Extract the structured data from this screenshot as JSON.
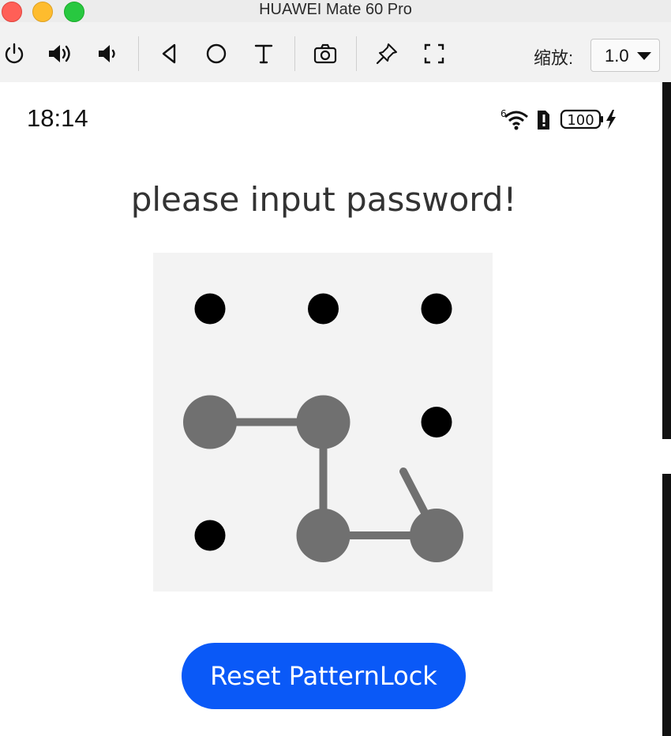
{
  "window": {
    "title": "HUAWEI Mate 60 Pro"
  },
  "toolbar": {
    "tools": [
      {
        "name": "power-icon"
      },
      {
        "name": "volume-up-icon"
      },
      {
        "name": "volume-down-icon"
      },
      {
        "name": "back-icon"
      },
      {
        "name": "home-icon"
      },
      {
        "name": "text-icon"
      },
      {
        "name": "camera-icon"
      },
      {
        "name": "pin-icon"
      },
      {
        "name": "fullscreen-icon"
      }
    ],
    "zoom_label": "缩放:",
    "zoom_value": "1.0"
  },
  "status_bar": {
    "time": "18:14",
    "battery": "100",
    "signal_badge": "6"
  },
  "screen": {
    "prompt": "please input password!",
    "reset_button_label": "Reset PatternLock"
  },
  "pattern_lock": {
    "grid_size": 3,
    "selected_sequence": [
      3,
      4,
      7,
      8
    ],
    "active_color": "#707070",
    "inactive_color": "#000000",
    "background_color": "#f3f3f3"
  },
  "colors": {
    "accent": "#0a59f7",
    "traffic_close": "#ff5f57",
    "traffic_minimize": "#febc2e",
    "traffic_maximize": "#28c840"
  }
}
